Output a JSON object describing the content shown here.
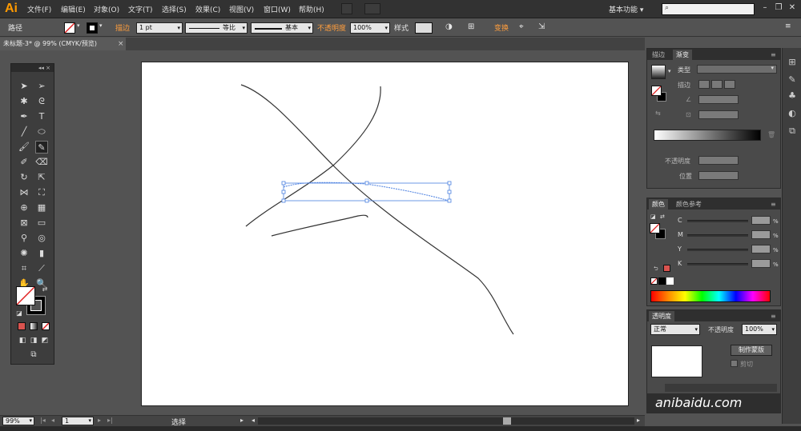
{
  "app": {
    "logo": "Ai"
  },
  "menu": [
    "文件(F)",
    "编辑(E)",
    "对象(O)",
    "文字(T)",
    "选择(S)",
    "效果(C)",
    "视图(V)",
    "窗口(W)",
    "帮助(H)"
  ],
  "workspace": {
    "label": "基本功能",
    "arrow": "▾"
  },
  "search": {
    "placeholder": ""
  },
  "window_buttons": [
    "–",
    "❐",
    "✕"
  ],
  "control": {
    "selection_label": "路径",
    "stroke_label": "描边",
    "stroke_weight": "1 pt",
    "profile_label": "等比",
    "brush_label": "基本",
    "opacity_label": "不透明度",
    "opacity_value": "100%",
    "style_label": "样式",
    "transform_label": "变换"
  },
  "document": {
    "tab_title": "未标题-3* @ 99% (CMYK/预览)",
    "close": "×"
  },
  "tools_panel": {
    "collapse": "◂◂ ×"
  },
  "status": {
    "zoom": "99%",
    "page": "1",
    "tool_label": "选择"
  },
  "gradient_panel": {
    "tabs": [
      "描边",
      "渐变"
    ],
    "type_label": "类型",
    "stroke_label": "描边",
    "opacity_label": "不透明度",
    "position_label": "位置"
  },
  "color_panel": {
    "tabs": [
      "颜色",
      "颜色参考"
    ],
    "channels": [
      "C",
      "M",
      "Y",
      "K"
    ],
    "percent": "%"
  },
  "transparency_panel": {
    "tab": "透明度",
    "blend_mode": "正常",
    "opacity_label": "不透明度",
    "opacity_value": "100%",
    "make_mask_button": "制作蒙版",
    "clip_label": "剪切"
  },
  "watermark_text": "anibaidu.com",
  "colors": {
    "accent": "#ff9a00",
    "selection": "#4a7fe0",
    "fill_swatch_red": "#d9534f"
  }
}
